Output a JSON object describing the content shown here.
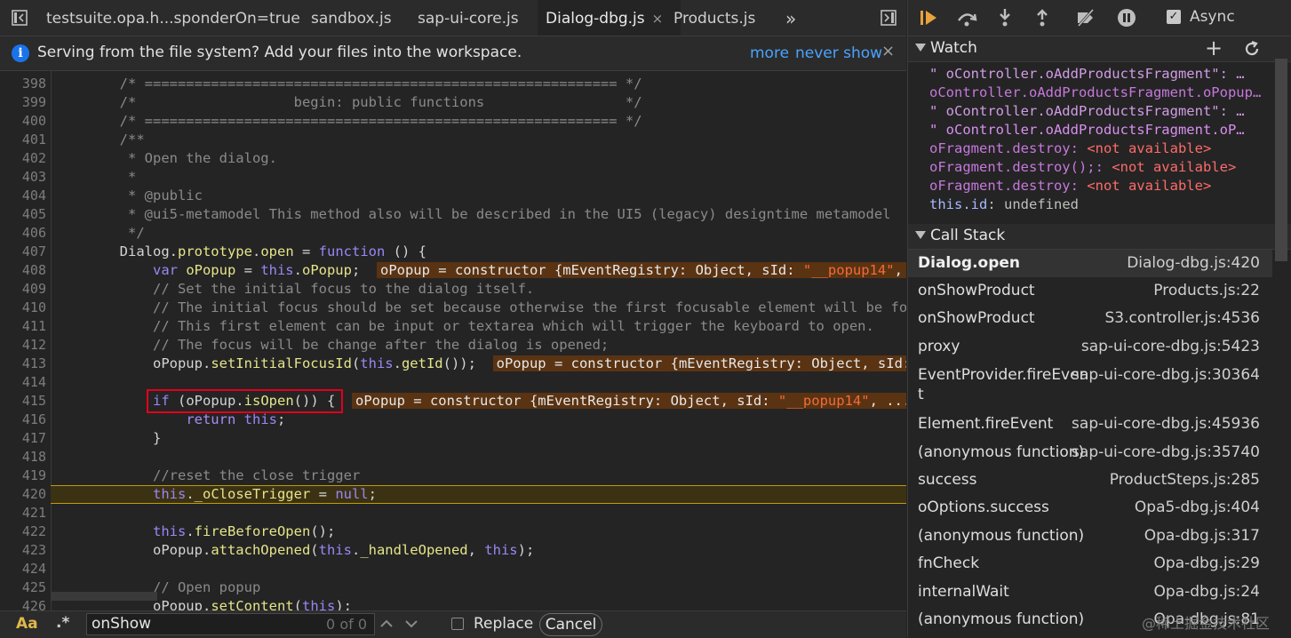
{
  "tabs": [
    {
      "label": "testsuite.opa.h...sponderOn=true",
      "active": false,
      "closable": false
    },
    {
      "label": "sandbox.js",
      "active": false,
      "closable": false
    },
    {
      "label": "sap-ui-core.js",
      "active": false,
      "closable": false
    },
    {
      "label": "Dialog-dbg.js",
      "active": true,
      "closable": true,
      "close_glyph": "×"
    },
    {
      "label": "Products.js",
      "active": false,
      "closable": false
    }
  ],
  "tab_overflow": "»",
  "infobar": {
    "message": "Serving from the file system? Add your files into the workspace.",
    "more": "more",
    "never_show": "never show",
    "close": "×",
    "icon": "info-icon"
  },
  "editor": {
    "execution_line": 420,
    "lines": [
      {
        "n": "398",
        "tokens": [
          [
            "c",
            "        /* ========================================================= */"
          ]
        ]
      },
      {
        "n": "399",
        "tokens": [
          [
            "c",
            "        /*                   begin: public functions                 */"
          ]
        ]
      },
      {
        "n": "400",
        "tokens": [
          [
            "c",
            "        /* ========================================================= */"
          ]
        ]
      },
      {
        "n": "401",
        "tokens": [
          [
            "c",
            "        /**"
          ]
        ]
      },
      {
        "n": "402",
        "tokens": [
          [
            "c",
            "         * Open the dialog."
          ]
        ]
      },
      {
        "n": "403",
        "tokens": [
          [
            "c",
            "         *"
          ]
        ]
      },
      {
        "n": "404",
        "tokens": [
          [
            "c",
            "         * @public"
          ]
        ]
      },
      {
        "n": "405",
        "tokens": [
          [
            "c",
            "         * @ui5-metamodel This method also will be described in the UI5 (legacy) designtime metamodel"
          ]
        ]
      },
      {
        "n": "406",
        "tokens": [
          [
            "c",
            "         */"
          ]
        ]
      },
      {
        "n": "407",
        "tokens": [
          [
            "i",
            "        Dialog."
          ],
          [
            "p",
            "prototype"
          ],
          [
            "i",
            "."
          ],
          [
            "p",
            "open"
          ],
          [
            "i",
            " = "
          ],
          [
            "k",
            "function"
          ],
          [
            "i",
            " () {"
          ]
        ]
      },
      {
        "n": "408",
        "tokens": [
          [
            "i",
            "            "
          ],
          [
            "k",
            "var"
          ],
          [
            "b",
            " oPopup"
          ],
          [
            "i",
            " = "
          ],
          [
            "k",
            "this"
          ],
          [
            "i",
            "."
          ],
          [
            "p",
            "oPopup"
          ],
          [
            "i",
            ";  "
          ]
        ],
        "inline": [
          "oPopup = constructor {mEventRegistry: Object, sId: ",
          "\"__popup14\"",
          ", ...}"
        ]
      },
      {
        "n": "409",
        "tokens": [
          [
            "c",
            "            // Set the initial focus to the dialog itself."
          ]
        ]
      },
      {
        "n": "410",
        "tokens": [
          [
            "c",
            "            // The initial focus should be set because otherwise the first focusable element will be focused."
          ]
        ]
      },
      {
        "n": "411",
        "tokens": [
          [
            "c",
            "            // This first element can be input or textarea which will trigger the keyboard to open."
          ]
        ]
      },
      {
        "n": "412",
        "tokens": [
          [
            "c",
            "            // The focus will be change after the dialog is opened;"
          ]
        ]
      },
      {
        "n": "413",
        "tokens": [
          [
            "i",
            "            oPopup."
          ],
          [
            "p",
            "setInitialFocusId"
          ],
          [
            "i",
            "("
          ],
          [
            "k",
            "this"
          ],
          [
            "i",
            "."
          ],
          [
            "p",
            "getId"
          ],
          [
            "i",
            "());  "
          ]
        ],
        "inline": [
          "oPopup = constructor {mEventRegistry: Object, sId: ",
          "\"__popup14\"",
          ", ...}"
        ]
      },
      {
        "n": "414",
        "tokens": [
          [
            "i",
            ""
          ]
        ]
      },
      {
        "n": "415",
        "tokens": [
          [
            "i",
            "            "
          ],
          [
            "k",
            "if"
          ],
          [
            "i",
            " (oPopup."
          ],
          [
            "p",
            "isOpen"
          ],
          [
            "i",
            "()) {  "
          ]
        ],
        "inline": [
          "oPopup = constructor {mEventRegistry: Object, sId: ",
          "\"__popup14\"",
          ", ...}"
        ]
      },
      {
        "n": "416",
        "tokens": [
          [
            "i",
            "                "
          ],
          [
            "r",
            "return"
          ],
          [
            "i",
            " "
          ],
          [
            "k",
            "this"
          ],
          [
            "i",
            ";"
          ]
        ]
      },
      {
        "n": "417",
        "tokens": [
          [
            "i",
            "            }"
          ]
        ]
      },
      {
        "n": "418",
        "tokens": [
          [
            "i",
            ""
          ]
        ]
      },
      {
        "n": "419",
        "tokens": [
          [
            "c",
            "            //reset the close trigger"
          ]
        ]
      },
      {
        "n": "420",
        "tokens": [
          [
            "i",
            "            "
          ],
          [
            "k",
            "this"
          ],
          [
            "i",
            "."
          ],
          [
            "p",
            "_oCloseTrigger"
          ],
          [
            "i",
            " = "
          ],
          [
            "k",
            "null"
          ],
          [
            "i",
            ";"
          ]
        ]
      },
      {
        "n": "421",
        "tokens": [
          [
            "i",
            ""
          ]
        ]
      },
      {
        "n": "422",
        "tokens": [
          [
            "i",
            "            "
          ],
          [
            "k",
            "this"
          ],
          [
            "i",
            "."
          ],
          [
            "p",
            "fireBeforeOpen"
          ],
          [
            "i",
            "();"
          ]
        ]
      },
      {
        "n": "423",
        "tokens": [
          [
            "i",
            "            oPopup."
          ],
          [
            "p",
            "attachOpened"
          ],
          [
            "i",
            "("
          ],
          [
            "k",
            "this"
          ],
          [
            "i",
            "."
          ],
          [
            "p",
            "_handleOpened"
          ],
          [
            "i",
            ", "
          ],
          [
            "k",
            "this"
          ],
          [
            "i",
            ");"
          ]
        ]
      },
      {
        "n": "424",
        "tokens": [
          [
            "i",
            ""
          ]
        ]
      },
      {
        "n": "425",
        "tokens": [
          [
            "c",
            "            // Open popup"
          ]
        ]
      },
      {
        "n": "426",
        "tokens": [
          [
            "i",
            "            oPopup."
          ],
          [
            "p",
            "setContent"
          ],
          [
            "i",
            "("
          ],
          [
            "k",
            "this"
          ],
          [
            "i",
            ");"
          ]
        ]
      }
    ]
  },
  "search": {
    "case_label": "Aa",
    "regex_label": ".*",
    "value": "onShow",
    "count": "0 of 0",
    "replace_label": "Replace",
    "cancel_label": "Cancel"
  },
  "debugger": {
    "async_label": "Async",
    "async_checked": true,
    "async_check_glyph": "✓"
  },
  "watch": {
    "title": "Watch",
    "add": "+",
    "entries": [
      {
        "parts": [
          [
            "purple2",
            "\" oController.oAddProductsFragment\": …"
          ]
        ]
      },
      {
        "parts": [
          [
            "purple",
            "oController.oAddProductsFragment.oPopup…"
          ]
        ]
      },
      {
        "parts": [
          [
            "purple2",
            "\" oController.oAddProductsFragment\": …"
          ]
        ]
      },
      {
        "parts": [
          [
            "bright",
            "\" oController.oAddProductsFragment.oP…"
          ]
        ]
      },
      {
        "parts": [
          [
            "purple",
            "oFragment.destroy: "
          ],
          [
            "na",
            "<not available>"
          ]
        ]
      },
      {
        "parts": [
          [
            "purple",
            "oFragment.destroy();: "
          ],
          [
            "na",
            "<not available>"
          ]
        ]
      },
      {
        "parts": [
          [
            "purple",
            "oFragment.destroy: "
          ],
          [
            "na",
            "<not available>"
          ]
        ]
      },
      {
        "parts": [
          [
            "blue",
            "this.id"
          ],
          [
            "grey",
            ": undefined"
          ]
        ]
      }
    ]
  },
  "callstack": {
    "title": "Call Stack",
    "frames": [
      {
        "fn": "Dialog.open",
        "loc": "Dialog-dbg.js:420",
        "active": true
      },
      {
        "fn": "onShowProduct",
        "loc": "Products.js:22"
      },
      {
        "fn": "onShowProduct",
        "loc": "S3.controller.js:4536"
      },
      {
        "fn": "proxy",
        "loc": "sap-ui-core-dbg.js:5423"
      },
      {
        "fn": "EventProvider.fireEven",
        "fn2": "t",
        "loc": "sap-ui-core-dbg.js:30364"
      },
      {
        "fn": "Element.fireEvent",
        "loc": "sap-ui-core-dbg.js:45936"
      },
      {
        "fn": "(anonymous function)",
        "loc": "sap-ui-core-dbg.js:35740"
      },
      {
        "fn": "success",
        "loc": "ProductSteps.js:285"
      },
      {
        "fn": "oOptions.success",
        "loc": "Opa5-dbg.js:404"
      },
      {
        "fn": "(anonymous function)",
        "loc": "Opa-dbg.js:317"
      },
      {
        "fn": "fnCheck",
        "loc": "Opa-dbg.js:29"
      },
      {
        "fn": "internalWait",
        "loc": "Opa-dbg.js:24"
      },
      {
        "fn": "(anonymous function)",
        "loc": "Opa-dbg.js:81"
      }
    ]
  },
  "watermark": "@稀土掘金技术社区",
  "colors": {
    "accent": "#1a73e8",
    "execution_line": "#c29c00",
    "highlight_box": "#e3001b"
  }
}
